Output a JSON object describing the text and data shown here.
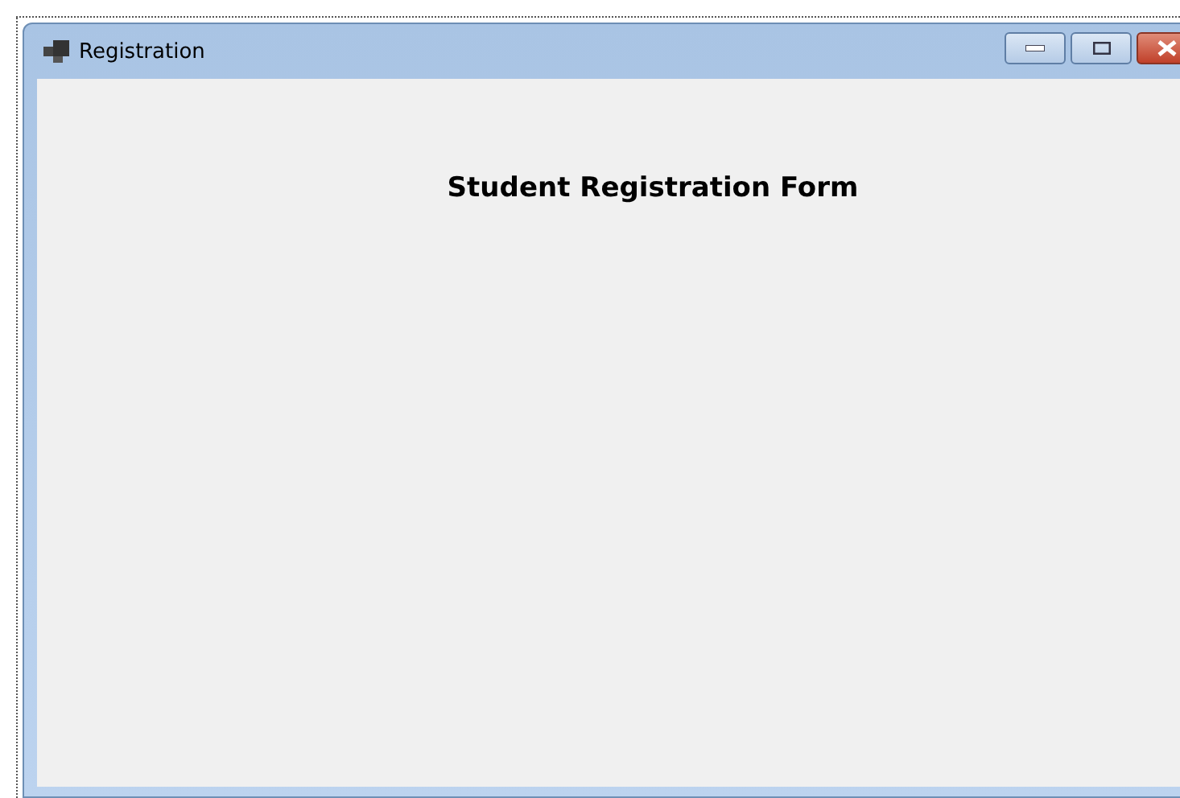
{
  "window": {
    "title": "Registration"
  },
  "form": {
    "heading": "Student Registration Form"
  }
}
